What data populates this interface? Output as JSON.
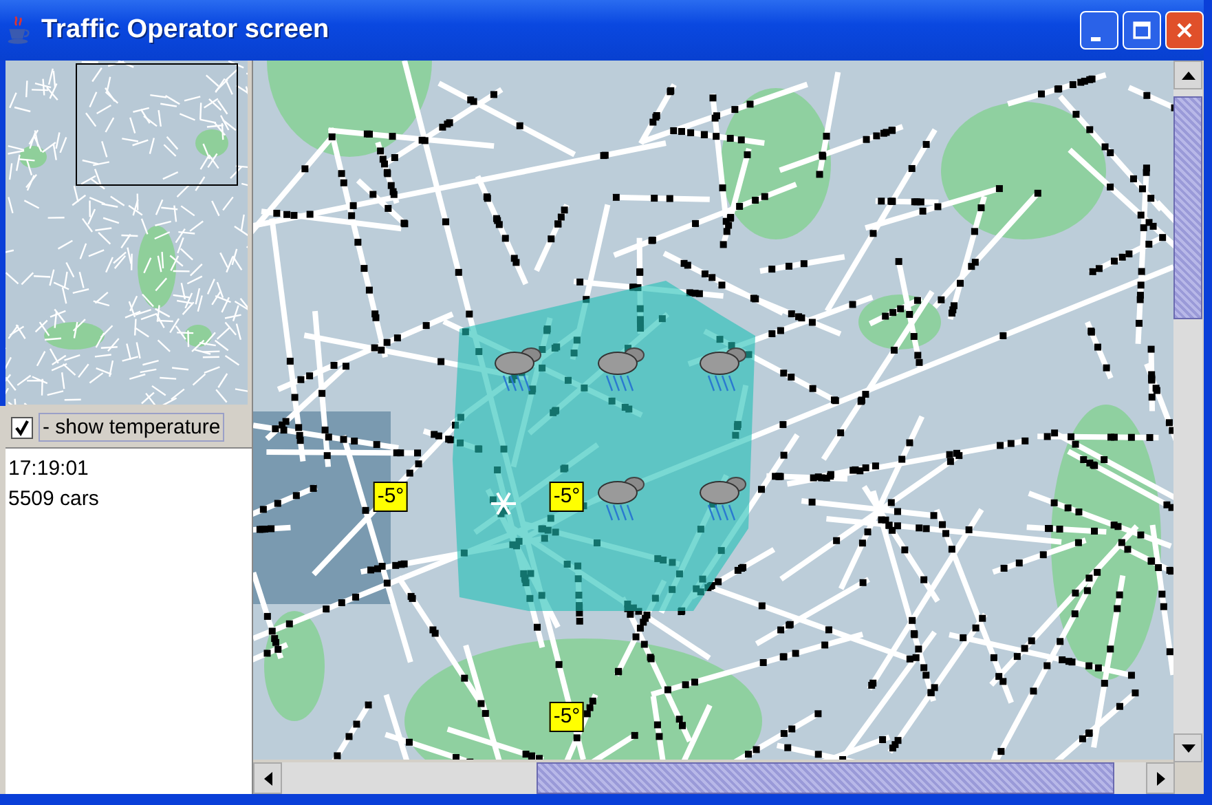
{
  "window": {
    "title": "Traffic Operator screen"
  },
  "show_temperature": {
    "label": "- show temperature",
    "checked": true
  },
  "status_lines": [
    "17:19:01",
    "5509 cars"
  ],
  "map": {
    "temperature_labels": [
      {
        "text": "-5°"
      },
      {
        "text": "-5°"
      },
      {
        "text": "-5°"
      }
    ],
    "weather_icons": [
      {
        "kind": "rain"
      },
      {
        "kind": "rain"
      },
      {
        "kind": "rain"
      },
      {
        "kind": "snow"
      },
      {
        "kind": "rain"
      },
      {
        "kind": "rain"
      }
    ]
  }
}
